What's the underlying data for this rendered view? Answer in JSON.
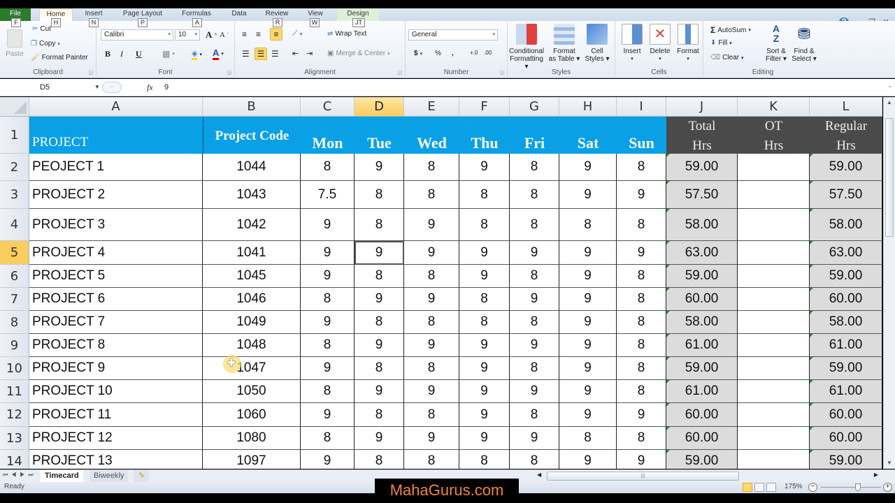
{
  "ribbon": {
    "tabs": [
      {
        "label": "File",
        "key": "F"
      },
      {
        "label": "Home",
        "key": "H"
      },
      {
        "label": "Insert",
        "key": "N"
      },
      {
        "label": "Page Layout",
        "key": "P"
      },
      {
        "label": "Formulas",
        "key": "M"
      },
      {
        "label": "Data",
        "key": "A"
      },
      {
        "label": "Review",
        "key": "R"
      },
      {
        "label": "View",
        "key": "W"
      },
      {
        "label": "Design",
        "key": "JT"
      }
    ],
    "clipboard": {
      "label": "Clipboard",
      "paste": "Paste",
      "cut": "Cut",
      "copy": "Copy",
      "format_painter": "Format Painter"
    },
    "font": {
      "label": "Font",
      "name": "Calibri",
      "size": "10",
      "bold": "B",
      "italic": "I",
      "underline": "U"
    },
    "alignment": {
      "label": "Alignment",
      "wrap_text": "Wrap Text",
      "merge_center": "Merge & Center"
    },
    "number": {
      "label": "Number",
      "format": "General",
      "currency": "$",
      "percent": "%",
      "comma": ","
    },
    "styles": {
      "label": "Styles",
      "conditional": [
        "Conditional",
        "Formatting"
      ],
      "format_table": [
        "Format",
        "as Table"
      ],
      "cell_styles": [
        "Cell",
        "Styles"
      ]
    },
    "cells": {
      "label": "Cells",
      "insert": "Insert",
      "delete": "Delete",
      "format": "Format"
    },
    "editing": {
      "label": "Editing",
      "autosum": "AutoSum",
      "fill": "Fill",
      "clear": "Clear",
      "sort": [
        "Sort &",
        "Filter"
      ],
      "find": [
        "Find &",
        "Select"
      ]
    }
  },
  "formula_bar": {
    "name_box": "D5",
    "fx": "fx",
    "value": "9"
  },
  "columns": [
    "A",
    "B",
    "C",
    "D",
    "E",
    "F",
    "G",
    "H",
    "I",
    "J",
    "K",
    "L"
  ],
  "selected_column": "D",
  "selected_row": 5,
  "header_row": {
    "row_number": "1",
    "project": "PROJECT",
    "code": "Project Code",
    "days": [
      "Mon",
      "Tue",
      "Wed",
      "Thu",
      "Fri",
      "Sat",
      "Sun"
    ],
    "total": [
      "Total",
      "Hrs"
    ],
    "ot": [
      "OT",
      "Hrs"
    ],
    "regular": [
      "Regular",
      "Hrs"
    ]
  },
  "rows": [
    {
      "num": "2",
      "project": "PEOJECT 1",
      "code": "1044",
      "hours": [
        "8",
        "9",
        "8",
        "9",
        "8",
        "9",
        "8"
      ],
      "total": "59.00",
      "ot": "",
      "regular": "59.00"
    },
    {
      "num": "3",
      "project": "PROJECT 2",
      "code": "1043",
      "hours": [
        "7.5",
        "8",
        "8",
        "8",
        "8",
        "9",
        "9"
      ],
      "total": "57.50",
      "ot": "",
      "regular": "57.50"
    },
    {
      "num": "4",
      "project": "PROJECT 3",
      "code": "1042",
      "hours": [
        "9",
        "8",
        "9",
        "8",
        "8",
        "8",
        "8"
      ],
      "total": "58.00",
      "ot": "",
      "regular": "58.00"
    },
    {
      "num": "5",
      "project": "PROJECT 4",
      "code": "1041",
      "hours": [
        "9",
        "9",
        "9",
        "9",
        "9",
        "9",
        "9"
      ],
      "total": "63.00",
      "ot": "",
      "regular": "63.00"
    },
    {
      "num": "6",
      "project": "PROJECT 5",
      "code": "1045",
      "hours": [
        "9",
        "8",
        "8",
        "9",
        "8",
        "9",
        "8"
      ],
      "total": "59.00",
      "ot": "",
      "regular": "59.00"
    },
    {
      "num": "7",
      "project": "PROJECT 6",
      "code": "1046",
      "hours": [
        "8",
        "9",
        "9",
        "8",
        "9",
        "9",
        "8"
      ],
      "total": "60.00",
      "ot": "",
      "regular": "60.00"
    },
    {
      "num": "8",
      "project": "PROJECT 7",
      "code": "1049",
      "hours": [
        "9",
        "8",
        "8",
        "8",
        "8",
        "9",
        "8"
      ],
      "total": "58.00",
      "ot": "",
      "regular": "58.00"
    },
    {
      "num": "9",
      "project": "PROJECT 8",
      "code": "1048",
      "hours": [
        "8",
        "9",
        "9",
        "9",
        "9",
        "9",
        "8"
      ],
      "total": "61.00",
      "ot": "",
      "regular": "61.00"
    },
    {
      "num": "10",
      "project": "PROJECT 9",
      "code": "1047",
      "hours": [
        "9",
        "8",
        "8",
        "9",
        "8",
        "9",
        "8"
      ],
      "total": "59.00",
      "ot": "",
      "regular": "59.00"
    },
    {
      "num": "11",
      "project": "PROJECT 10",
      "code": "1050",
      "hours": [
        "8",
        "9",
        "9",
        "9",
        "9",
        "9",
        "8"
      ],
      "total": "61.00",
      "ot": "",
      "regular": "61.00"
    },
    {
      "num": "12",
      "project": "PROJECT 11",
      "code": "1060",
      "hours": [
        "9",
        "8",
        "8",
        "9",
        "8",
        "9",
        "9"
      ],
      "total": "60.00",
      "ot": "",
      "regular": "60.00"
    },
    {
      "num": "13",
      "project": "PROJECT 12",
      "code": "1080",
      "hours": [
        "8",
        "9",
        "9",
        "9",
        "9",
        "8",
        "8"
      ],
      "total": "60.00",
      "ot": "",
      "regular": "60.00"
    },
    {
      "num": "14",
      "project": "PROJECT 13",
      "code": "1097",
      "hours": [
        "9",
        "8",
        "8",
        "8",
        "8",
        "9",
        "9"
      ],
      "total": "59.00",
      "ot": "",
      "regular": "59.00"
    }
  ],
  "sheets": [
    {
      "label": "Timecard",
      "active": true
    },
    {
      "label": "Biweekly",
      "active": false
    }
  ],
  "status": {
    "ready": "Ready",
    "zoom": "175%"
  },
  "watermark": "MahaGurus.com",
  "colors": {
    "header_blue": "#0aa0e6",
    "header_dark": "#4a4a4a",
    "total_gray": "#dcdcdc",
    "selection": "#f9cd5e"
  }
}
